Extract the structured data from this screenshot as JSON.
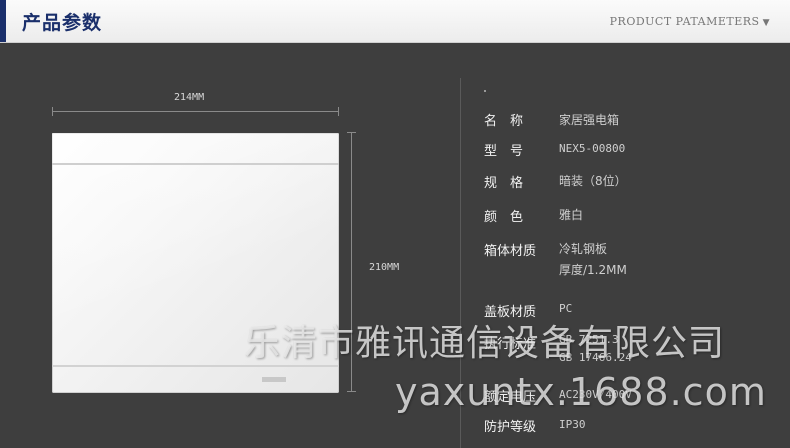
{
  "header": {
    "title_cn": "产品参数",
    "title_en": "PRODUCT PATAMETERS",
    "arrow": "▼"
  },
  "dimensions": {
    "width_label": "214MM",
    "height_label": "210MM"
  },
  "specs": [
    {
      "label": "名　称",
      "value": "家居强电箱"
    },
    {
      "label": "型　号",
      "value": "NEX5-00800"
    },
    {
      "label": "规　格",
      "value": "暗装（8位）"
    },
    {
      "label": "颜　色",
      "value": "雅白"
    },
    {
      "label": "箱体材质",
      "value": "冷轧钢板",
      "value2": "厚度/1.2MM"
    },
    {
      "label": "盖板材质",
      "value": "PC"
    },
    {
      "label": "执行标准",
      "value": "GB 7251.3",
      "value2": "GB 17466.24"
    },
    {
      "label": "额定电压",
      "value": "AC230V/400V"
    },
    {
      "label": "防护等级",
      "value": "IP30"
    }
  ],
  "watermark": {
    "company": "乐清市雅讯通信设备有限公司",
    "site": "yaxuntx.1688.com"
  }
}
